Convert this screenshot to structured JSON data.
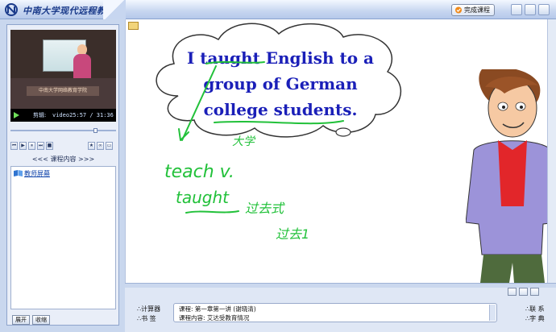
{
  "app": {
    "logo_text": "中南大学现代远程教育",
    "finish_button": "完成课程"
  },
  "video": {
    "banner_text": "中南大学网络教育学院",
    "status_label": "剪辑:",
    "time": "video25:57 / 31:36",
    "progress": 0.82
  },
  "toc": {
    "header": "<<< 课程内容 >>>",
    "items": [
      {
        "label": "教师屏幕"
      }
    ],
    "expand_label": "展开",
    "collapse_label": "收缩"
  },
  "slide": {
    "sentence_lines": [
      "I taught English to a",
      "group of German",
      "college students."
    ],
    "handwriting": [
      "大学",
      "teach v.",
      "taught",
      "过去式",
      "过去1"
    ],
    "ink_color": "#22c13a",
    "text_color": "#1a1fb8"
  },
  "bottom": {
    "calculator_label": "∴计算器",
    "bookmark_label": "∴书  签",
    "contact_label": "∴联  系",
    "dictionary_label": "∴字  典",
    "course_line": "课程: 第一章第一讲 (谢晓清)",
    "content_line": "课程内容: 艾达受教育情况"
  }
}
